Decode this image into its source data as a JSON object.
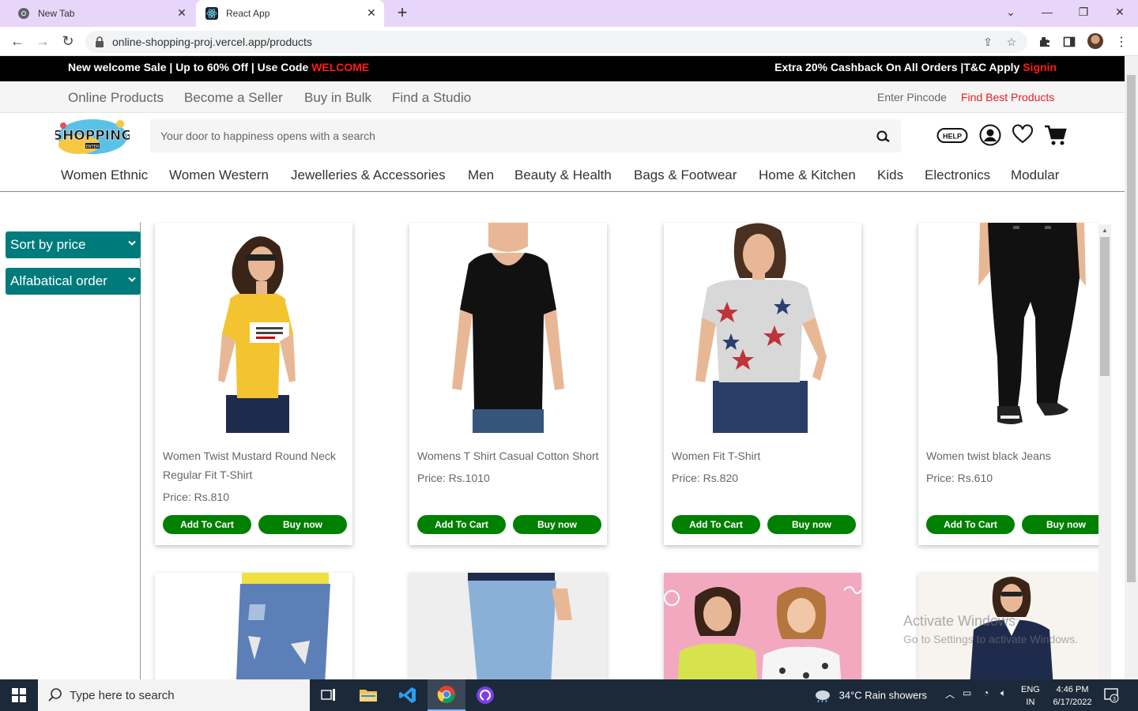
{
  "browser": {
    "tabs": [
      {
        "title": "New Tab",
        "active": false
      },
      {
        "title": "React App",
        "active": true
      }
    ],
    "url": "online-shopping-proj.vercel.app/products"
  },
  "promo": {
    "left_text": "New welcome Sale | Up to 60% Off | Use Code ",
    "code": "WELCOME",
    "right_text": "Extra 20% Cashback On All Orders |T&C Apply ",
    "signin": "Signin"
  },
  "topnav": {
    "links": [
      "Online Products",
      "Become a Seller",
      "Buy in Bulk",
      "Find a Studio"
    ],
    "pincode": "Enter Pincode",
    "best": "Find Best Products"
  },
  "header": {
    "logo_text": "SHOPPING",
    "logo_sub": "ENTER",
    "search_placeholder": "Your door to happiness opens with a search",
    "help_label": "HELP"
  },
  "categories": [
    "Women Ethnic",
    "Women Western",
    "Jewelleries & Accessories",
    "Men",
    "Beauty & Health",
    "Bags & Footwear",
    "Home & Kitchen",
    "Kids",
    "Electronics",
    "Modular"
  ],
  "filters": {
    "sort_price": "Sort by price",
    "alpha_order": "Alfabatical order"
  },
  "products": [
    {
      "name": "Women Twist Mustard Round Neck Regular Fit T-Shirt",
      "price": "Price: Rs.810"
    },
    {
      "name": "Womens T Shirt Casual Cotton Short",
      "price": "Price: Rs.1010"
    },
    {
      "name": "Women Fit T-Shirt",
      "price": "Price: Rs.820"
    },
    {
      "name": "Women twist black Jeans",
      "price": "Price: Rs.610"
    }
  ],
  "buttons": {
    "add_to_cart": "Add To Cart",
    "buy_now": "Buy now"
  },
  "watermark": {
    "title": "Activate Windows",
    "subtitle": "Go to Settings to activate Windows."
  },
  "taskbar": {
    "search_placeholder": "Type here to search",
    "weather": "34°C  Rain showers",
    "lang1": "ENG",
    "lang2": "IN",
    "time": "4:46 PM",
    "date": "6/17/2022",
    "notifications": "3"
  },
  "colors": {
    "tabbar": "#e8d6fa",
    "promo_bg": "#000000",
    "promo_accent": "#ff1a1a",
    "filter_bg": "#007b7b",
    "button_green": "#008000",
    "find_best_red": "#e0202a",
    "taskbar": "#1c2938"
  }
}
